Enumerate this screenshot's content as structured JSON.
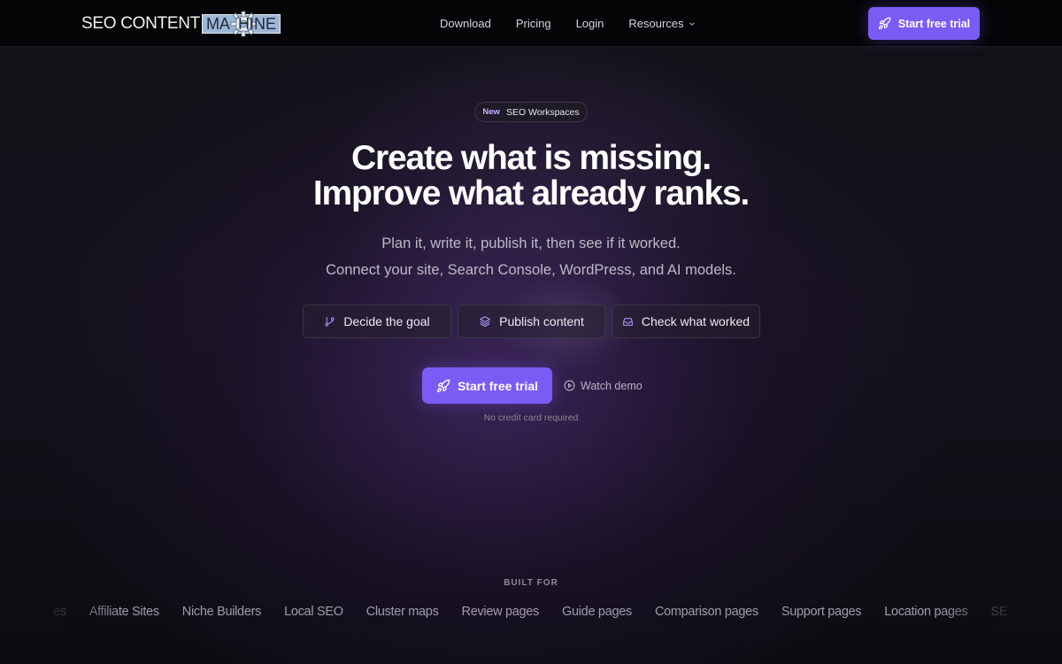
{
  "nav": {
    "logo_main": "SEO CONTENT",
    "logo_box": "MA  HINE",
    "links": [
      {
        "label": "Download"
      },
      {
        "label": "Pricing"
      },
      {
        "label": "Login"
      },
      {
        "label": "Resources"
      }
    ],
    "cta_label": "Start free trial"
  },
  "hero": {
    "badge_tag": "New",
    "badge_text": "SEO Workspaces",
    "headline_1": "Create what is missing.",
    "headline_2": "Improve what already ranks.",
    "sub_1": "Plan it, write it, publish it, then see if it worked.",
    "sub_2": "Connect your site, Search Console, WordPress, and AI models.",
    "steps": [
      {
        "label": "Decide the goal",
        "icon": "git-branch-icon"
      },
      {
        "label": "Publish content",
        "icon": "layers-icon"
      },
      {
        "label": "Check what worked",
        "icon": "inbox-icon"
      }
    ],
    "cta_label": "Start free trial",
    "watch_label": "Watch demo",
    "no_cc": "No credit card required"
  },
  "built_for": {
    "heading": "BUILT FOR",
    "items": [
      "es",
      "Affiliate Sites",
      "Niche Builders",
      "Local SEO",
      "Cluster maps",
      "Review pages",
      "Guide pages",
      "Comparison pages",
      "Support pages",
      "Location pages",
      "SE"
    ]
  },
  "colors": {
    "accent": "#7a5cf5",
    "nav_bg": "#050507",
    "badge_tag": "#c6b5ff"
  }
}
